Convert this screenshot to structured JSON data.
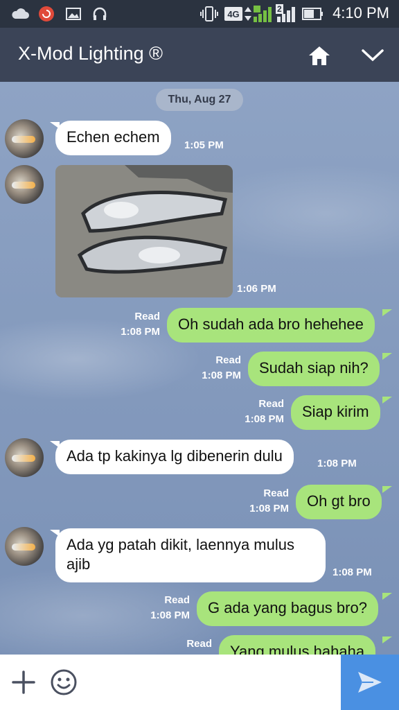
{
  "status_bar": {
    "time": "4:10 PM",
    "network": "4G",
    "sim2": "2",
    "icons": [
      "cloud-icon",
      "app-notification-icon",
      "gallery-icon",
      "headphones-icon",
      "vibrate-icon",
      "signal-icon",
      "battery-icon"
    ]
  },
  "header": {
    "title": "X-Mod Lighting ®",
    "home_icon": "home-icon",
    "menu_icon": "chevron-down-icon"
  },
  "chat": {
    "date": "Thu, Aug 27",
    "messages": [
      {
        "from": "them",
        "text": "Echen echem",
        "time": "1:05 PM"
      },
      {
        "from": "them",
        "type": "image",
        "time": "1:06 PM"
      },
      {
        "from": "me",
        "text": "Oh sudah ada bro hehehee",
        "status": "Read",
        "time": "1:08 PM"
      },
      {
        "from": "me",
        "text": "Sudah siap nih?",
        "status": "Read",
        "time": "1:08 PM"
      },
      {
        "from": "me",
        "text": "Siap kirim",
        "status": "Read",
        "time": "1:08 PM"
      },
      {
        "from": "them",
        "text": "Ada tp kakinya lg dibenerin dulu",
        "time": "1:08 PM"
      },
      {
        "from": "me",
        "text": "Oh gt bro",
        "status": "Read",
        "time": "1:08 PM"
      },
      {
        "from": "them",
        "text": "Ada yg patah dikit, laennya mulus\najib",
        "time": "1:08 PM"
      },
      {
        "from": "me",
        "text": "G ada yang bagus bro?",
        "status": "Read",
        "time": "1:08 PM"
      },
      {
        "from": "me",
        "text": "Yang mulus hahaha",
        "status": "Read",
        "time": ""
      }
    ]
  },
  "composer": {
    "add_icon": "plus-icon",
    "emoji_icon": "smiley-icon",
    "send_icon": "send-icon"
  },
  "colors": {
    "header": "#3b4457",
    "status_bar": "#2b3340",
    "bubble_out": "#a8e47c",
    "bubble_in": "#ffffff",
    "send": "#4a90e2"
  }
}
